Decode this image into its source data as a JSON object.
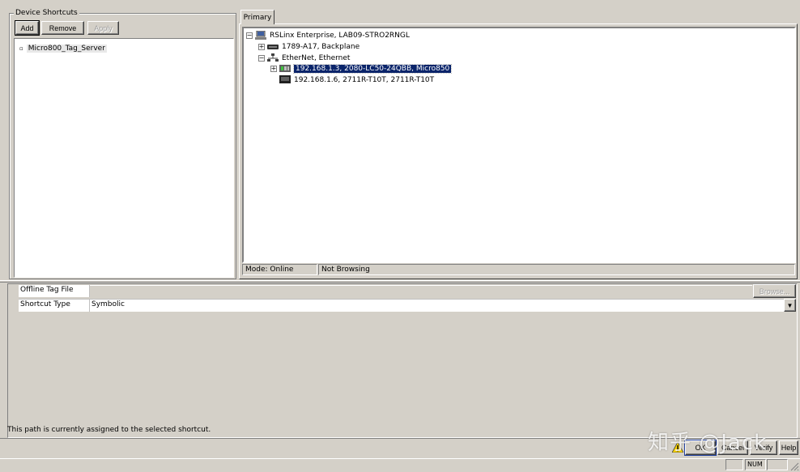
{
  "device_shortcuts": {
    "title": "Device Shortcuts",
    "add_label": "Add",
    "remove_label": "Remove",
    "apply_label": "Apply",
    "items": [
      {
        "label": "Micro800_Tag_Server"
      }
    ]
  },
  "primary_tab": {
    "label": "Primary"
  },
  "tree": {
    "root": "RSLinx Enterprise, LAB09-STRO2RNGL",
    "backplane": "1789-A17, Backplane",
    "ethernet": "EtherNet, Ethernet",
    "device1": "192.168.1.3, 2080-LC50-24QBB, Micro850",
    "device2": "192.168.1.6, 2711R-T10T, 2711R-T10T"
  },
  "tree_status": {
    "mode": "Mode: Online",
    "browsing": "Not Browsing"
  },
  "properties": {
    "offline_tag_file_label": "Offline Tag File",
    "offline_tag_file_value": "",
    "browse_label": "Browse...",
    "shortcut_type_label": "Shortcut Type",
    "shortcut_type_value": "Symbolic",
    "dropdown_arrow": "▼"
  },
  "info_text": "This path is currently assigned to the selected shortcut.",
  "buttons": {
    "ok": "OK",
    "cancel": "Cancel",
    "verify": "Verify",
    "help": "Help"
  },
  "statusbar": {
    "num": "NUM"
  },
  "watermark": "知乎 @Jack"
}
